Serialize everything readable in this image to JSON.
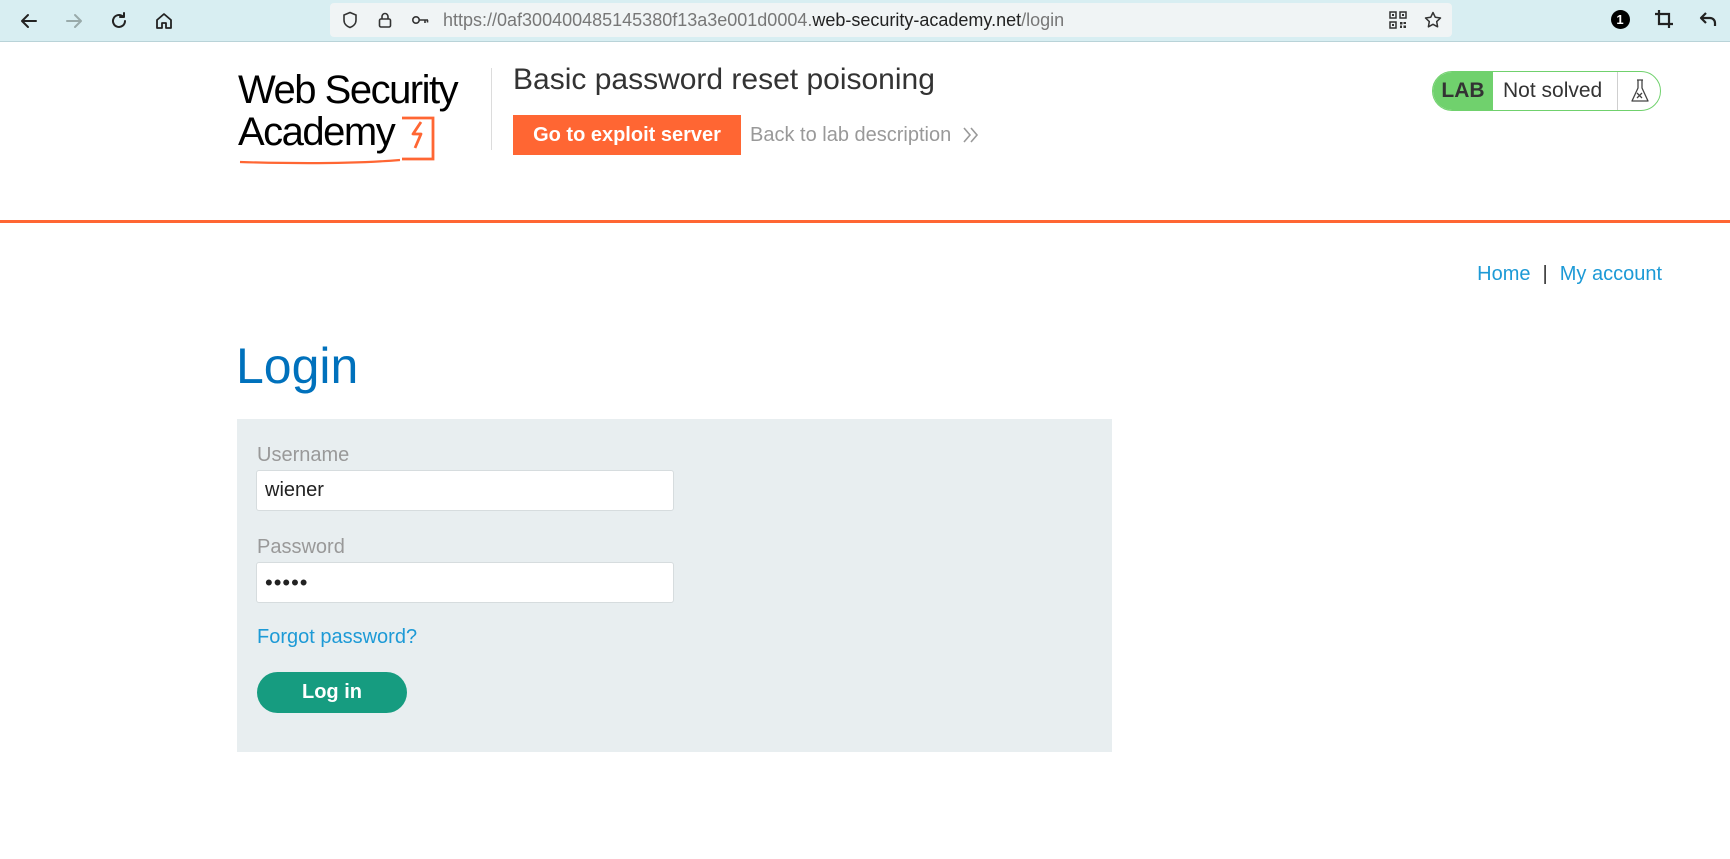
{
  "browser": {
    "url_prefix": "https://0af300400485145380f13a3e001d0004.",
    "url_domain": "web-security-academy.net",
    "url_path": "/login",
    "extension_badge": "1"
  },
  "header": {
    "logo_line1": "Web Security",
    "logo_line2": "Academy",
    "lab_title": "Basic password reset poisoning",
    "exploit_button": "Go to exploit server",
    "back_link": "Back to lab description",
    "status_tag": "LAB",
    "status_text": "Not solved"
  },
  "nav": {
    "home": "Home",
    "separator": "|",
    "my_account": "My account"
  },
  "login": {
    "heading": "Login",
    "username_label": "Username",
    "username_value": "wiener",
    "password_label": "Password",
    "password_value": "•••••",
    "forgot_link": "Forgot password?",
    "submit": "Log in"
  },
  "colors": {
    "accent_orange": "#ff6633",
    "lab_green": "#70d16d",
    "link_blue": "#1d9ad6",
    "heading_blue": "#0071bc",
    "button_teal": "#169c80"
  }
}
